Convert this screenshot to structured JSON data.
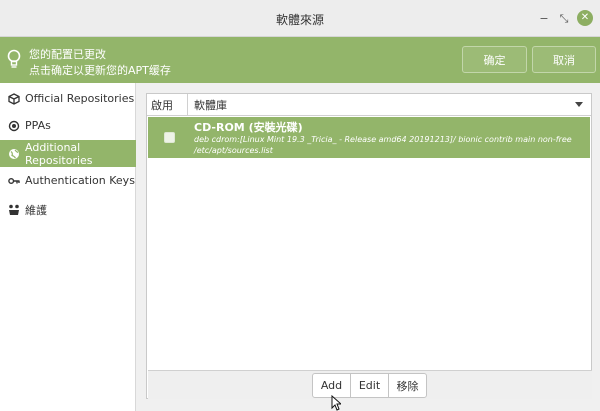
{
  "window": {
    "title": "軟體來源",
    "controls": {
      "minimize": "−",
      "maximize": "⤡",
      "close": "✕"
    }
  },
  "infobar": {
    "line1": "您的配置已更改",
    "line2": "点击确定以更新您的APT缓存",
    "ok_label": "确定",
    "cancel_label": "取消",
    "icon": "lightbulb-icon"
  },
  "sidebar": {
    "items": [
      {
        "label": "Official Repositories",
        "icon": "package-icon",
        "active": false
      },
      {
        "label": "PPAs",
        "icon": "target-icon",
        "active": false
      },
      {
        "label": "Additional Repositories",
        "icon": "globe-icon",
        "active": true
      },
      {
        "label": "Authentication Keys",
        "icon": "key-icon",
        "active": false
      },
      {
        "label": "維護",
        "icon": "tools-icon",
        "active": false
      }
    ]
  },
  "table": {
    "headers": {
      "enabled": "啟用",
      "repository": "軟體庫"
    },
    "rows": [
      {
        "enabled": false,
        "title": "CD-ROM (安裝光碟)",
        "line1": "deb cdrom:[Linux Mint 19.3 _Tricia_ - Release amd64 20191213]/ bionic contrib main non-free",
        "line2": "/etc/apt/sources.list"
      }
    ]
  },
  "toolbar": {
    "add_label": "Add",
    "edit_label": "Edit",
    "remove_label": "移除"
  },
  "colors": {
    "accent": "#93b56a",
    "close_button": "#8dae62"
  }
}
